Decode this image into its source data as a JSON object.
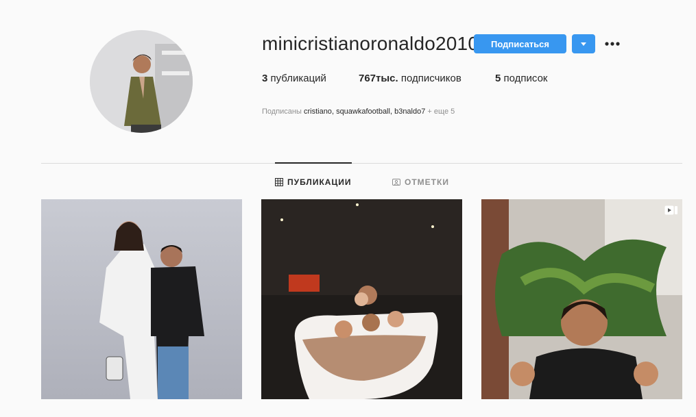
{
  "profile": {
    "username": "minicristianoronaldo2010",
    "follow_label": "Подписаться",
    "stats": {
      "posts_count": "3",
      "posts_label": "публикаций",
      "followers_count": "767тыс.",
      "followers_label": "подписчиков",
      "following_count": "5",
      "following_label": "подписок"
    },
    "followed_by": {
      "prefix": "Подписаны",
      "accounts": [
        "cristiano",
        "squawkafootball",
        "b3naldo7"
      ],
      "more": "+ еще 5"
    }
  },
  "tabs": [
    {
      "label": "ПУБЛИКАЦИИ",
      "icon": "grid-icon",
      "active": true
    },
    {
      "label": "ОТМЕТКИ",
      "icon": "tag-person-icon",
      "active": false
    }
  ],
  "colors": {
    "accent": "#3897f0",
    "background": "#fafafa",
    "text": "#262626",
    "muted": "#8e8e8e",
    "divider": "#dbdbdb"
  },
  "posts": [
    {
      "type": "photo"
    },
    {
      "type": "photo"
    },
    {
      "type": "video",
      "icon": "video-icon"
    }
  ]
}
